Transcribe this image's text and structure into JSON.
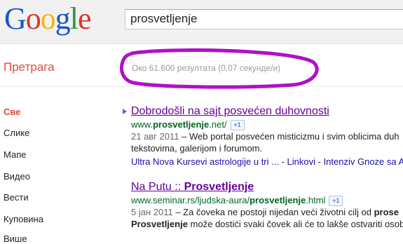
{
  "logo": {
    "text": "Google",
    "letters": [
      "G",
      "o",
      "o",
      "g",
      "l",
      "e"
    ]
  },
  "search": {
    "query": "prosvetljenje"
  },
  "section_title": "Претрага",
  "result_stats": "Око 61.600 резултата (0,07 секунде/и)",
  "sidebar": {
    "items": [
      {
        "label": "Све"
      },
      {
        "label": "Слике"
      },
      {
        "label": "Мапе"
      },
      {
        "label": "Видео"
      },
      {
        "label": "Вести"
      },
      {
        "label": "Куповина"
      },
      {
        "label": "Више"
      }
    ]
  },
  "results": [
    {
      "title": "Dobrodošli na sajt posvećen duhovnosti",
      "url_pre": "www.",
      "url_bold": "prosvetljenje",
      "url_post": ".net/",
      "plus_label": "+1",
      "date": "21 авг 2011",
      "snippet_1": " – Web portal posvećen misticizmu i svim oblicima duh",
      "snippet_2": "tekstovima, galerijom i forumom.",
      "sitelinks": [
        "Ultra Nova Kursevi astrologije u tri ...",
        "Linkovi",
        "Intenziv Gnoze sa A"
      ],
      "sitelink_sep": " - "
    },
    {
      "title_pre": "Na Putu :: ",
      "title_bold": "Prosvetljenje",
      "url_pre": "www.seminar.rs/ljudska-aura/",
      "url_bold": "prosvetljenje",
      "url_post": ".html",
      "plus_label": "+1",
      "date": "5 јан 2011",
      "snippet_1": " – Za čoveka ne postoji nijedan veći životni cilj od ",
      "snippet_1_bold": "prose",
      "snippet_2_bold": "Prosvetljenje",
      "snippet_2": " može dostići svaki čovek ali će to lakše ostvariti osob"
    }
  ],
  "colors": {
    "logo": [
      "#1a55c9",
      "#d9362b",
      "#f2b612",
      "#1a55c9",
      "#2a9a3a",
      "#d9362b"
    ],
    "accent_red": "#dd4b39",
    "link": "#1a0dab",
    "visited": "#660099",
    "url_green": "#006621",
    "annotation": "#b010c8"
  },
  "icons": {
    "plus_one": "google-plus-one-icon",
    "arrow": "result-arrow-icon"
  }
}
